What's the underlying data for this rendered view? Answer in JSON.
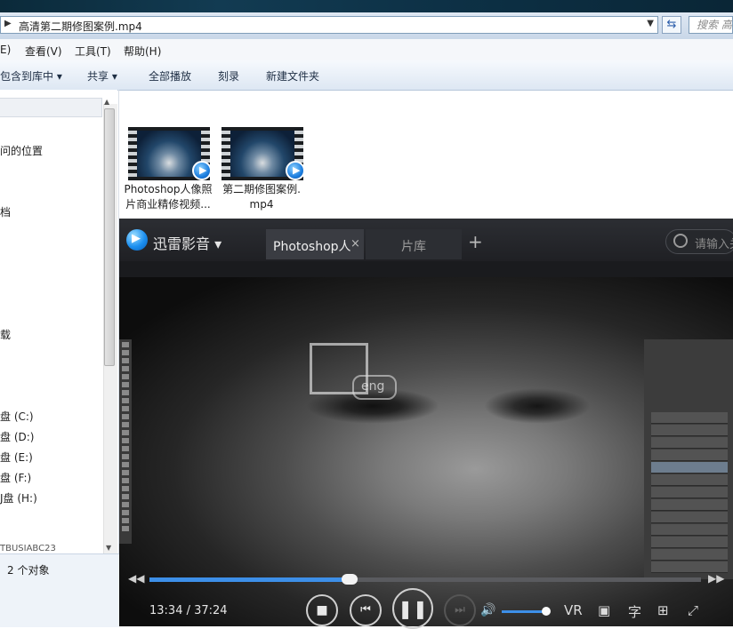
{
  "explorer": {
    "path": "高清第二期修图案例.mp4",
    "search_placeholder": "搜索 高",
    "menu": [
      "E)",
      "查看(V)",
      "工具(T)",
      "帮助(H)"
    ],
    "toolbar": [
      "包含到库中 ▾",
      "共享 ▾",
      "全部播放",
      "刻录",
      "新建文件夹"
    ],
    "nav": [
      "问的位置",
      "档",
      "载",
      "盘 (C:)",
      "盘 (D:)",
      "盘 (E:)",
      "盘 (F:)",
      "J盘 (H:)",
      "TBUSIABC23"
    ],
    "status": "2 个对象",
    "files": [
      {
        "line1": "Photoshop人像照",
        "line2": "片商业精修视频..."
      },
      {
        "line1": "第二期修图案例.",
        "line2": "mp4"
      }
    ]
  },
  "player": {
    "app_name": "迅雷影音 ▾",
    "tab_active": "Photoshop人",
    "tab_close": "×",
    "tab_library": "片库",
    "tab_add": "+",
    "search_placeholder": "请输入关",
    "time": "13:34 / 37:24",
    "progress": 0.363,
    "volume": 0.9,
    "vr_label": "VR",
    "subtitle_label": "字",
    "watermark": "eng"
  }
}
